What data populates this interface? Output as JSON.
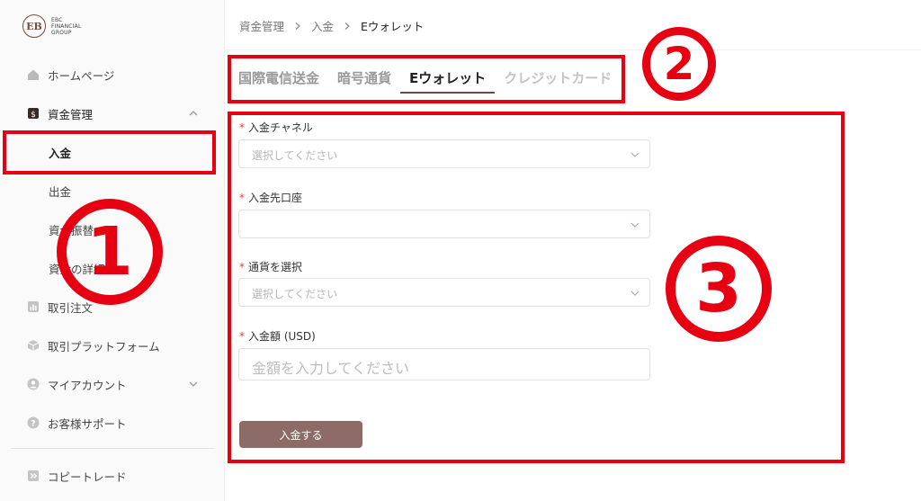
{
  "logo": {
    "mark": "EB",
    "line1": "EBC",
    "line2": "FINANCIAL",
    "line3": "GROUP"
  },
  "sidebar": {
    "items": [
      {
        "label": "ホームページ",
        "icon": "home-icon"
      },
      {
        "label": "資金管理",
        "icon": "wallet-icon",
        "expanded": true
      },
      {
        "label": "入金",
        "active": true
      },
      {
        "label": "出金"
      },
      {
        "label": "資金振替"
      },
      {
        "label": "資金の詳細"
      },
      {
        "label": "取引注文",
        "icon": "chart-icon"
      },
      {
        "label": "取引プラットフォーム",
        "icon": "cube-icon"
      },
      {
        "label": "マイアカウント",
        "icon": "user-icon"
      },
      {
        "label": "お客様サポート",
        "icon": "help-icon"
      },
      {
        "label": "コピートレード",
        "icon": "copy-trade-icon"
      }
    ]
  },
  "breadcrumb": {
    "items": [
      "資金管理",
      "入金",
      "Eウォレット"
    ]
  },
  "tabs": [
    {
      "label": "国際電信送金"
    },
    {
      "label": "暗号通貨"
    },
    {
      "label": "Eウォレット",
      "active": true
    },
    {
      "label": "クレジットカード",
      "disabled": true
    }
  ],
  "form": {
    "channel_label": "入金チャネル",
    "channel_placeholder": "選択してください",
    "account_label": "入金先口座",
    "account_value": "",
    "currency_label": "通貨を選択",
    "currency_placeholder": "選択してください",
    "amount_label": "入金額 (USD)",
    "amount_placeholder": "金額を入力してください",
    "required_mark": "*",
    "submit_label": "入金する"
  },
  "annotations": {
    "one": "1",
    "two": "2",
    "three": "3",
    "color": "#e60012"
  },
  "colors": {
    "brand": "#8d6b66",
    "required": "#e63e3e"
  }
}
